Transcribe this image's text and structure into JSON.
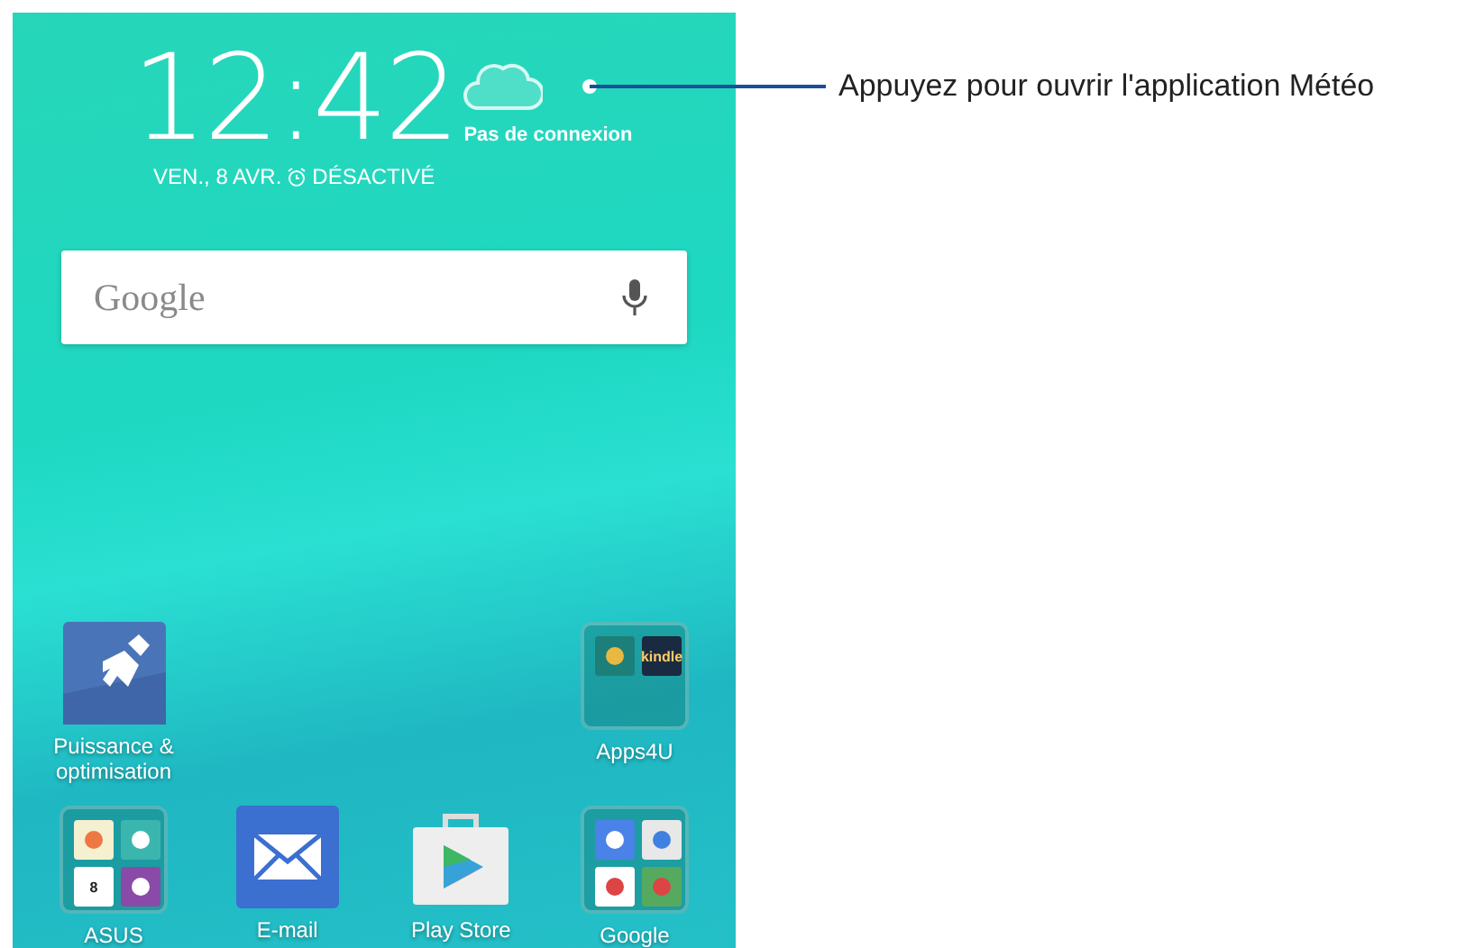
{
  "clock": {
    "time": "12:42",
    "date": "VEN., 8 AVR.",
    "alarm": "DÉSACTIVÉ"
  },
  "weather": {
    "status": "Pas de connexion"
  },
  "search": {
    "placeholder": "Google"
  },
  "top_row": [
    {
      "kind": "cleaner",
      "label": "Puissance & optimisation"
    },
    {
      "kind": "folder",
      "label": "Apps4U",
      "items": [
        {
          "kind": "broom"
        },
        {
          "kind": "kindle",
          "text": "kindle"
        }
      ]
    }
  ],
  "dock": [
    {
      "kind": "folder",
      "label": "ASUS",
      "items": [
        {
          "kind": "balloon"
        },
        {
          "kind": "contacts"
        },
        {
          "kind": "calendar",
          "text": "8"
        },
        {
          "kind": "tasks"
        }
      ]
    },
    {
      "kind": "mail",
      "label": "E-mail"
    },
    {
      "kind": "store",
      "label": "Play Store"
    },
    {
      "kind": "folder",
      "label": "Google",
      "items": [
        {
          "kind": "gsearch"
        },
        {
          "kind": "chrome"
        },
        {
          "kind": "gmail"
        },
        {
          "kind": "maps"
        }
      ]
    }
  ],
  "callout": {
    "text": "Appuyez pour ouvrir l'application Météo"
  }
}
